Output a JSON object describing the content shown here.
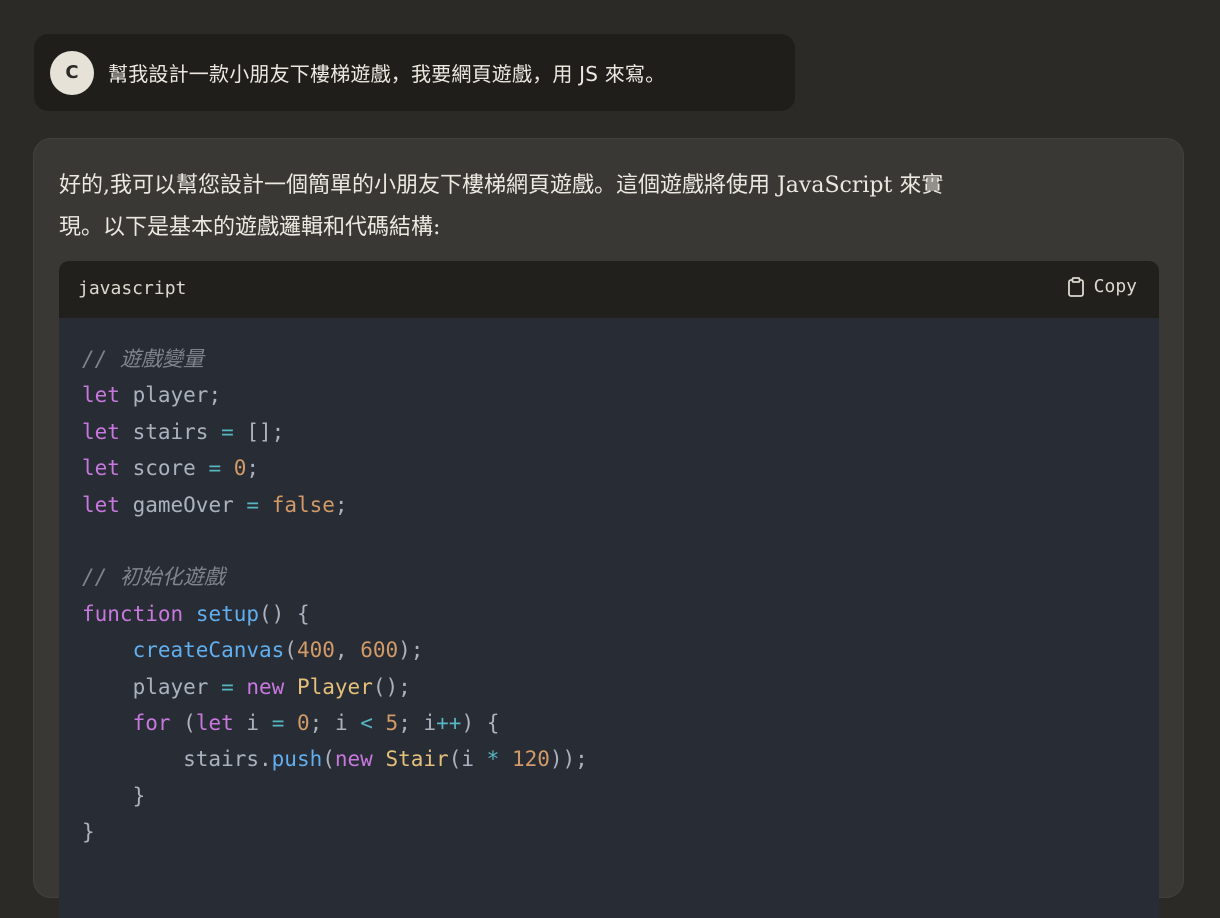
{
  "user_message": {
    "avatar_initial": "C",
    "text": "幫我設計一款小朋友下樓梯遊戲，我要網頁遊戲，用 JS 來寫。"
  },
  "assistant_message": {
    "text_line1": "好的,我可以幫您設計一個簡單的小朋友下樓梯網頁遊戲。這個遊戲將使用 JavaScript 來實",
    "text_line2": "現。以下是基本的遊戲邏輯和代碼結構:",
    "code_block": {
      "language": "javascript",
      "copy_label": "Copy",
      "copy_icon": "clipboard-icon",
      "lines": [
        [
          {
            "t": "// 遊戲變量",
            "c": "c"
          }
        ],
        [
          {
            "t": "let",
            "c": "k"
          },
          {
            "t": " player;",
            "c": ""
          }
        ],
        [
          {
            "t": "let",
            "c": "k"
          },
          {
            "t": " stairs ",
            "c": ""
          },
          {
            "t": "=",
            "c": "o"
          },
          {
            "t": " [];",
            "c": ""
          }
        ],
        [
          {
            "t": "let",
            "c": "k"
          },
          {
            "t": " score ",
            "c": ""
          },
          {
            "t": "=",
            "c": "o"
          },
          {
            "t": " ",
            "c": ""
          },
          {
            "t": "0",
            "c": "n"
          },
          {
            "t": ";",
            "c": ""
          }
        ],
        [
          {
            "t": "let",
            "c": "k"
          },
          {
            "t": " gameOver ",
            "c": ""
          },
          {
            "t": "=",
            "c": "o"
          },
          {
            "t": " ",
            "c": ""
          },
          {
            "t": "false",
            "c": "n"
          },
          {
            "t": ";",
            "c": ""
          }
        ],
        [],
        [
          {
            "t": "// 初始化遊戲",
            "c": "c"
          }
        ],
        [
          {
            "t": "function",
            "c": "k"
          },
          {
            "t": " ",
            "c": ""
          },
          {
            "t": "setup",
            "c": "f"
          },
          {
            "t": "() {",
            "c": ""
          }
        ],
        [
          {
            "t": "    ",
            "c": ""
          },
          {
            "t": "createCanvas",
            "c": "f"
          },
          {
            "t": "(",
            "c": ""
          },
          {
            "t": "400",
            "c": "n"
          },
          {
            "t": ", ",
            "c": ""
          },
          {
            "t": "600",
            "c": "n"
          },
          {
            "t": ");",
            "c": ""
          }
        ],
        [
          {
            "t": "    player ",
            "c": ""
          },
          {
            "t": "=",
            "c": "o"
          },
          {
            "t": " ",
            "c": ""
          },
          {
            "t": "new",
            "c": "k"
          },
          {
            "t": " ",
            "c": ""
          },
          {
            "t": "Player",
            "c": "t"
          },
          {
            "t": "();",
            "c": ""
          }
        ],
        [
          {
            "t": "    ",
            "c": ""
          },
          {
            "t": "for",
            "c": "k"
          },
          {
            "t": " (",
            "c": ""
          },
          {
            "t": "let",
            "c": "k"
          },
          {
            "t": " i ",
            "c": ""
          },
          {
            "t": "=",
            "c": "o"
          },
          {
            "t": " ",
            "c": ""
          },
          {
            "t": "0",
            "c": "n"
          },
          {
            "t": "; i ",
            "c": ""
          },
          {
            "t": "<",
            "c": "o"
          },
          {
            "t": " ",
            "c": ""
          },
          {
            "t": "5",
            "c": "n"
          },
          {
            "t": "; i",
            "c": ""
          },
          {
            "t": "++",
            "c": "o"
          },
          {
            "t": ") {",
            "c": ""
          }
        ],
        [
          {
            "t": "        stairs.",
            "c": ""
          },
          {
            "t": "push",
            "c": "f"
          },
          {
            "t": "(",
            "c": ""
          },
          {
            "t": "new",
            "c": "k"
          },
          {
            "t": " ",
            "c": ""
          },
          {
            "t": "Stair",
            "c": "t"
          },
          {
            "t": "(i ",
            "c": ""
          },
          {
            "t": "*",
            "c": "o"
          },
          {
            "t": " ",
            "c": ""
          },
          {
            "t": "120",
            "c": "n"
          },
          {
            "t": "));",
            "c": ""
          }
        ],
        [
          {
            "t": "    }",
            "c": ""
          }
        ],
        [
          {
            "t": "}",
            "c": ""
          }
        ]
      ]
    }
  },
  "colors": {
    "background": "#2b2a27",
    "user_bubble": "#1f1e1b",
    "assistant_card": "#393835",
    "code_header": "#21201c",
    "code_body": "#282c34"
  }
}
